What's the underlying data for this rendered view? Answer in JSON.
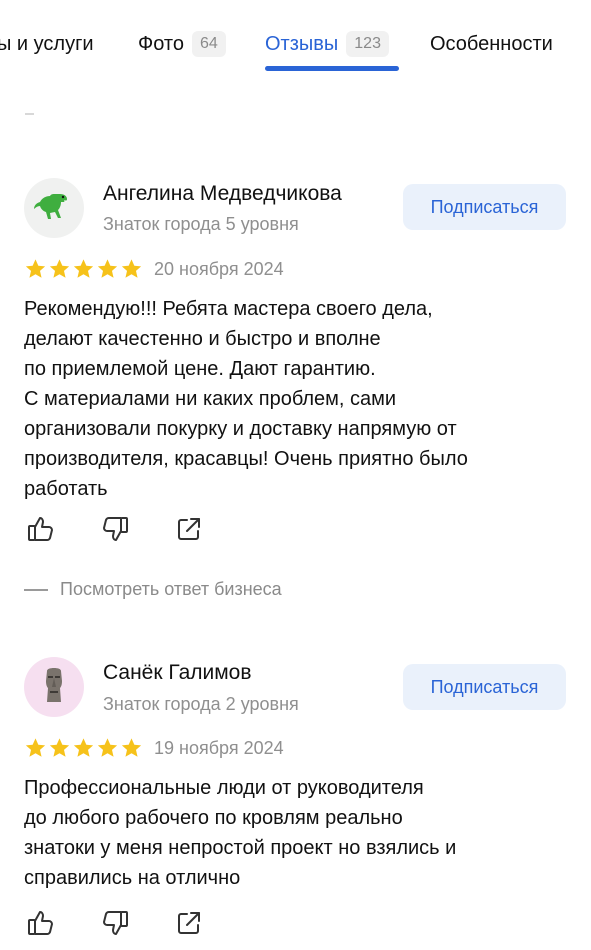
{
  "tabs": [
    {
      "label": "ы и услуги",
      "count": null
    },
    {
      "label": "Фото",
      "count": "64"
    },
    {
      "label": "Отзывы",
      "count": "123",
      "active": true
    },
    {
      "label": "Особенности",
      "count": null
    }
  ],
  "reviews": [
    {
      "author": "Ангелина Медведчикова",
      "level": "Знаток города 5 уровня",
      "subscribe": "Подписаться",
      "rating": 5,
      "date": "20 ноября 2024",
      "text_lines": [
        "Рекомендую!!! Ребята мастера своего дела,",
        "делают качестенно и быстро и вполне",
        "по приемлемой цене. Дают гарантию.",
        "С материалами ни каких проблем, сами",
        "организовали покурку и доставку напрямую от",
        "производителя, красавцы! Очень приятно было",
        "работать"
      ],
      "business_reply": "Посмотреть ответ бизнеса"
    },
    {
      "author": "Санёк Галимов",
      "level": "Знаток города 2 уровня",
      "subscribe": "Подписаться",
      "rating": 5,
      "date": "19 ноября 2024",
      "text_lines": [
        "Профессиональные люди от руководителя",
        "до любого рабочего по кровлям реально",
        "знатоки у меня непростой проект но взялись и",
        "справились на отлично"
      ]
    }
  ],
  "colors": {
    "accent": "#2a64d6",
    "star": "#f6c21a",
    "muted": "#8f8f8f"
  }
}
